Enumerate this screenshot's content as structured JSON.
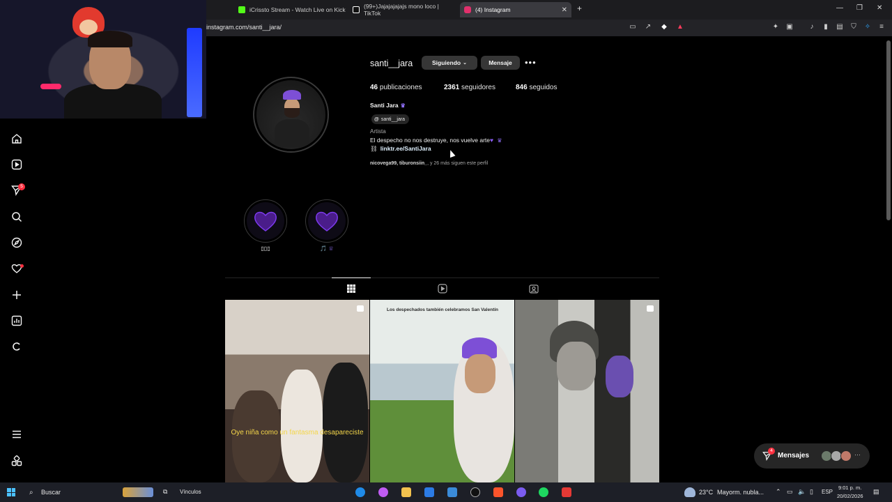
{
  "browser": {
    "tabs": [
      {
        "title": "iCrissto Stream - Watch Live on Kick",
        "icon": "kick-icon",
        "color": "#53fc18"
      },
      {
        "title": "(99+)Jajajajajajs mono loco | TikTok",
        "icon": "tiktok-icon",
        "color": "#ffffff"
      },
      {
        "title": "(4) Instagram",
        "icon": "instagram-icon",
        "color": "#e1306c",
        "close": "✕"
      }
    ],
    "new_tab": "+",
    "url": "instagram.com/santi__jara/"
  },
  "sidebar": {
    "notifications_badge": "5"
  },
  "profile": {
    "username": "santi__jara",
    "following_button": "Siguiendo",
    "message_button": "Mensaje",
    "more": "•••",
    "stats": [
      {
        "value": "46",
        "label": "publicaciones"
      },
      {
        "value": "2361",
        "label": "seguidores"
      },
      {
        "value": "846",
        "label": "seguidos"
      }
    ],
    "full_name": "Santi Jara",
    "threads_handle": "santi__jara",
    "category": "Artista",
    "bio": "El despecho no nos destruye, nos vuelve arte",
    "link": "linktr.ee/SantiJara",
    "followed_by_users": "nicovega99, tiburonsiin_",
    "followed_by_rest": ", y 26 más siguen este perfil"
  },
  "highlights": [
    {
      "label": "▯▯▯"
    },
    {
      "label": "🎵 ♕"
    }
  ],
  "posts": [
    {
      "overlay_text": "Oye niña como un fantasma desapareciste"
    },
    {
      "caption": "Los despechados también celebramos San Valentín"
    },
    {
      "caption": ""
    }
  ],
  "messages": {
    "label": "Mensajes",
    "badge": "4"
  },
  "taskbar": {
    "search": "Buscar",
    "links": "Vínculos",
    "weather_temp": "23°C",
    "weather_text": "Mayorm. nubla...",
    "lang": "ESP",
    "time": "9:01 p. m.",
    "date": "20/02/2026"
  }
}
